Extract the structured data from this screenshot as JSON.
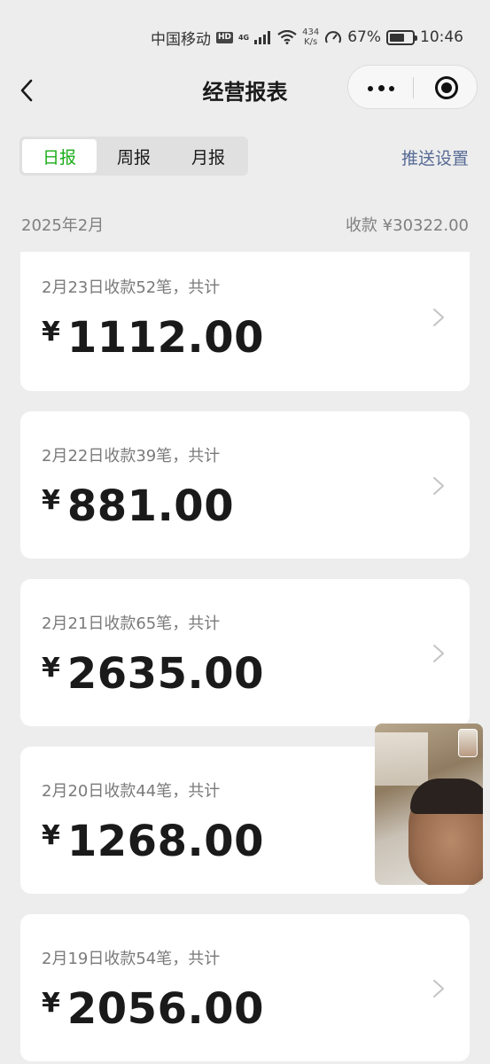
{
  "status_bar": {
    "carrier": "中国移动",
    "hd_badge": "HD",
    "network_type": "4G",
    "net_speed_value": "434",
    "net_speed_unit": "K/s",
    "battery_percent": "67%",
    "battery_level": 0.67,
    "time": "10:46",
    "icons": [
      "signal-icon",
      "wifi-icon",
      "speedometer-icon",
      "battery-icon"
    ]
  },
  "nav": {
    "title": "经营报表",
    "back_icon": "chevron-left-icon",
    "more_icon": "more-dots-icon",
    "close_icon": "target-circle-icon"
  },
  "tabs": [
    {
      "label": "日报",
      "active": true
    },
    {
      "label": "周报",
      "active": false
    },
    {
      "label": "月报",
      "active": false
    }
  ],
  "push_settings": "推送设置",
  "month": {
    "label": "2025年2月",
    "total": "收款 ¥30322.00"
  },
  "records": [
    {
      "desc": "2月23日收款52笔，共计",
      "currency": "¥",
      "amount": "1112.00"
    },
    {
      "desc": "2月22日收款39笔，共计",
      "currency": "¥",
      "amount": "881.00"
    },
    {
      "desc": "2月21日收款65笔，共计",
      "currency": "¥",
      "amount": "2635.00"
    },
    {
      "desc": "2月20日收款44笔，共计",
      "currency": "¥",
      "amount": "1268.00"
    },
    {
      "desc": "2月19日收款54笔，共计",
      "currency": "¥",
      "amount": "2056.00"
    }
  ],
  "colors": {
    "background": "#ededed",
    "active_tab": "#1aad19",
    "link": "#576b95",
    "secondary_text": "#7a7a7a"
  }
}
